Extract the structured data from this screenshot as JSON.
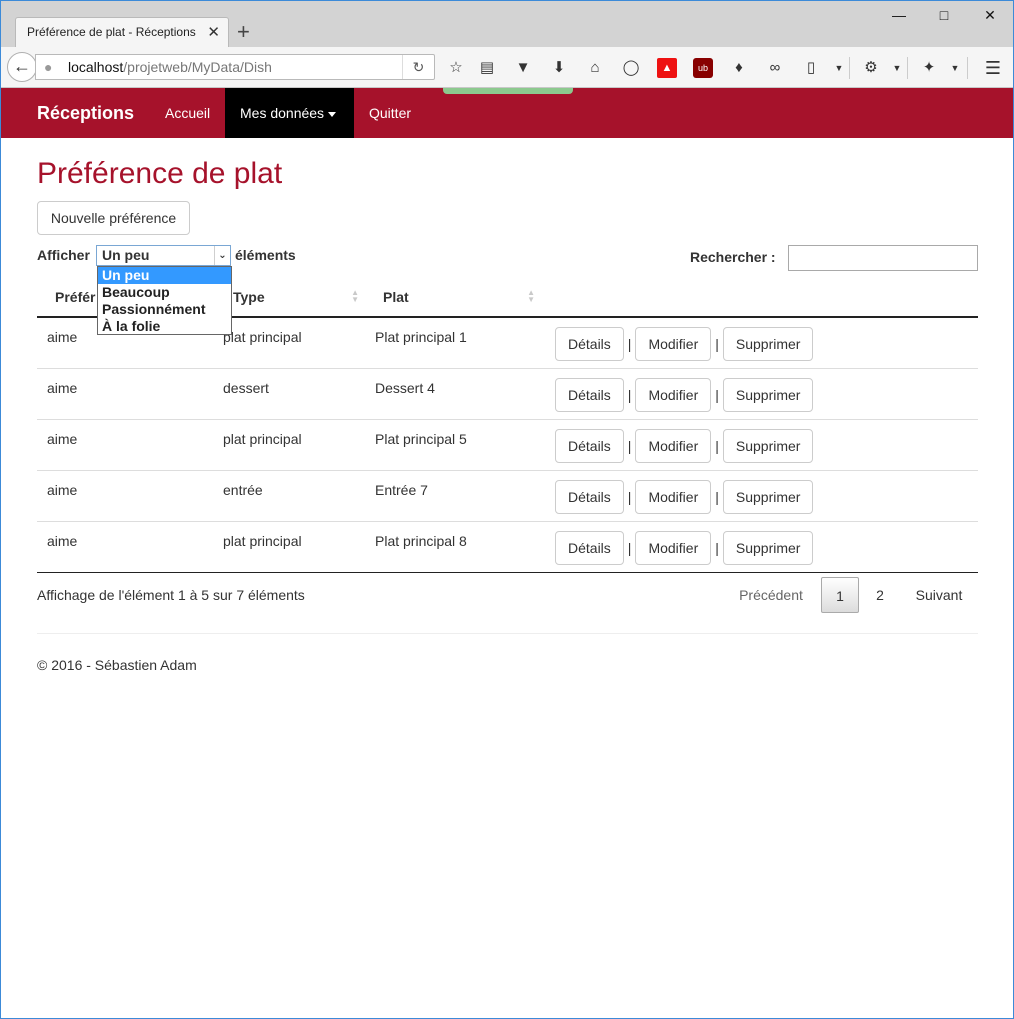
{
  "browser": {
    "tab_title": "Préférence de plat - Réceptions",
    "tab_close": "✕",
    "new_tab": "+",
    "url_host": "localhost",
    "url_path": "/projetweb/MyData/Dish",
    "icons": [
      "star-icon",
      "reading-list-icon",
      "pocket-icon",
      "download-icon",
      "home-icon",
      "chat-icon",
      "pdf-icon",
      "ublock-icon",
      "extension-icon",
      "bubbles-icon",
      "clipboard-icon",
      "gear-icon",
      "tools-icon",
      "menu-icon"
    ]
  },
  "navbar": {
    "brand": "Réceptions",
    "items": [
      {
        "label": "Accueil"
      },
      {
        "label": "Mes données"
      },
      {
        "label": "Quitter"
      }
    ],
    "color": "#a6122b"
  },
  "page": {
    "title": "Préférence de plat",
    "new_button": "Nouvelle préférence",
    "length_label": "Afficher",
    "length_value": "Un peu",
    "length_suffix": "éléments",
    "length_options": [
      "Un peu",
      "Beaucoup",
      "Passionnément",
      "À la folie"
    ],
    "search_label": "Rechercher :",
    "search_value": ""
  },
  "table": {
    "columns": [
      "Préférence",
      "Type",
      "Plat"
    ],
    "column_visible": [
      "Préfér",
      "Type",
      "Plat"
    ],
    "rows": [
      {
        "pref": "aime",
        "type": "plat principal",
        "dish": "Plat principal 1"
      },
      {
        "pref": "aime",
        "type": "dessert",
        "dish": "Dessert 4"
      },
      {
        "pref": "aime",
        "type": "plat principal",
        "dish": "Plat principal 5"
      },
      {
        "pref": "aime",
        "type": "entrée",
        "dish": "Entrée 7"
      },
      {
        "pref": "aime",
        "type": "plat principal",
        "dish": "Plat principal 8"
      }
    ],
    "actions": {
      "details": "Détails",
      "edit": "Modifier",
      "delete": "Supprimer",
      "separator": "|"
    }
  },
  "pagination": {
    "info": "Affichage de l'élément 1 à 5 sur 7 éléments",
    "previous": "Précédent",
    "pages": [
      "1",
      "2"
    ],
    "current_page": "1",
    "next": "Suivant"
  },
  "footer": {
    "text": "© 2016 - Sébastien Adam"
  }
}
